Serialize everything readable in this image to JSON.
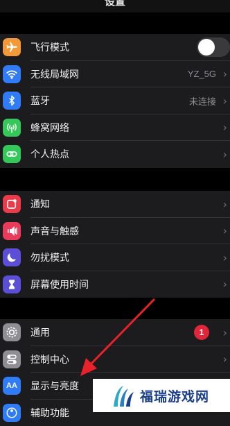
{
  "header": {
    "title": "设置"
  },
  "group1": {
    "items": [
      {
        "label": "飞行模式",
        "icon": "airplane-icon",
        "color": "#f19a37",
        "toggle": false
      },
      {
        "label": "无线局域网",
        "icon": "wifi-icon",
        "color": "#2f7cf6",
        "value": "YZ_5G"
      },
      {
        "label": "蓝牙",
        "icon": "bluetooth-icon",
        "color": "#2f7cf6",
        "value": "未连接"
      },
      {
        "label": "蜂窝网络",
        "icon": "cellular-icon",
        "color": "#34c759"
      },
      {
        "label": "个人热点",
        "icon": "hotspot-icon",
        "color": "#34c759"
      }
    ]
  },
  "group2": {
    "items": [
      {
        "label": "通知",
        "icon": "notification-icon",
        "color": "#eb3b4a"
      },
      {
        "label": "声音与触感",
        "icon": "sound-icon",
        "color": "#eb3b5a"
      },
      {
        "label": "勿扰模式",
        "icon": "moon-icon",
        "color": "#5b4fd8"
      },
      {
        "label": "屏幕使用时间",
        "icon": "hourglass-icon",
        "color": "#5b4fd8"
      }
    ]
  },
  "group3": {
    "items": [
      {
        "label": "通用",
        "icon": "gear-icon",
        "color": "#8e8e93",
        "badge": "1"
      },
      {
        "label": "控制中心",
        "icon": "toggles-icon",
        "color": "#8e8e93"
      },
      {
        "label": "显示与亮度",
        "icon": "display-icon",
        "color": "#2f7cf6"
      },
      {
        "label": "辅助功能",
        "icon": "accessibility-icon",
        "color": "#2f7cf6"
      }
    ]
  },
  "annotation": {
    "color": "#e8212b"
  },
  "watermark": {
    "text": "福瑞游戏网"
  }
}
